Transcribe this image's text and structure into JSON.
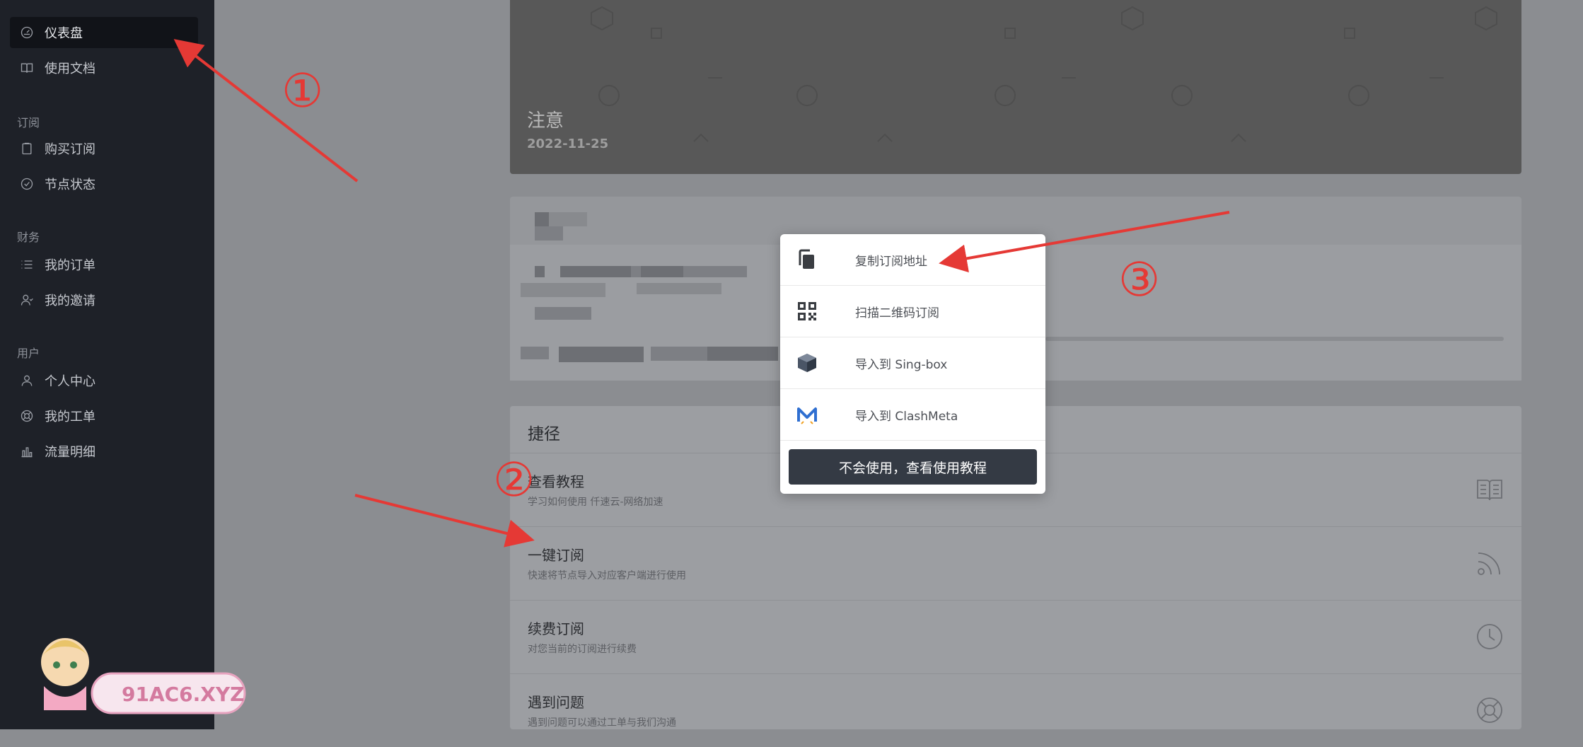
{
  "sidebar": {
    "items": [
      {
        "label": "仪表盘",
        "icon": "dashboard-icon",
        "active": true
      },
      {
        "label": "使用文档",
        "icon": "book-icon"
      }
    ],
    "groups": [
      {
        "title": "订阅",
        "items": [
          {
            "label": "购买订阅",
            "icon": "clipboard-icon"
          },
          {
            "label": "节点状态",
            "icon": "check-circle-icon"
          }
        ]
      },
      {
        "title": "财务",
        "items": [
          {
            "label": "我的订单",
            "icon": "list-icon"
          },
          {
            "label": "我的邀请",
            "icon": "users-icon"
          }
        ]
      },
      {
        "title": "用户",
        "items": [
          {
            "label": "个人中心",
            "icon": "user-icon"
          },
          {
            "label": "我的工单",
            "icon": "lifebuoy-icon"
          },
          {
            "label": "流量明细",
            "icon": "bar-chart-icon"
          }
        ]
      }
    ]
  },
  "banner": {
    "title": "注意",
    "date": "2022-11-25"
  },
  "shortcuts": {
    "title": "捷径",
    "items": [
      {
        "title": "查看教程",
        "desc": "学习如何使用 仟速云-网络加速",
        "icon": "book-open-icon"
      },
      {
        "title": "一键订阅",
        "desc": "快速将节点导入对应客户端进行使用",
        "icon": "rss-icon"
      },
      {
        "title": "续费订阅",
        "desc": "对您当前的订阅进行续费",
        "icon": "clock-icon"
      },
      {
        "title": "遇到问题",
        "desc": "遇到问题可以通过工单与我们沟通",
        "icon": "lifebuoy-icon"
      }
    ]
  },
  "popup": {
    "items": [
      {
        "label": "复制订阅地址",
        "icon": "copy-icon"
      },
      {
        "label": "扫描二维码订阅",
        "icon": "qrcode-icon"
      },
      {
        "label": "导入到 Sing-box",
        "icon": "singbox-icon"
      },
      {
        "label": "导入到 ClashMeta",
        "icon": "clashmeta-icon"
      }
    ],
    "button_label": "不会使用，查看使用教程"
  },
  "annotations": {
    "marks": [
      "①",
      "②",
      "③"
    ]
  },
  "watermark": {
    "text": "91AC6.XYZ"
  },
  "colors": {
    "accent_red": "#e53935",
    "sidebar_bg": "#1e2128",
    "button_bg": "#343a44"
  }
}
